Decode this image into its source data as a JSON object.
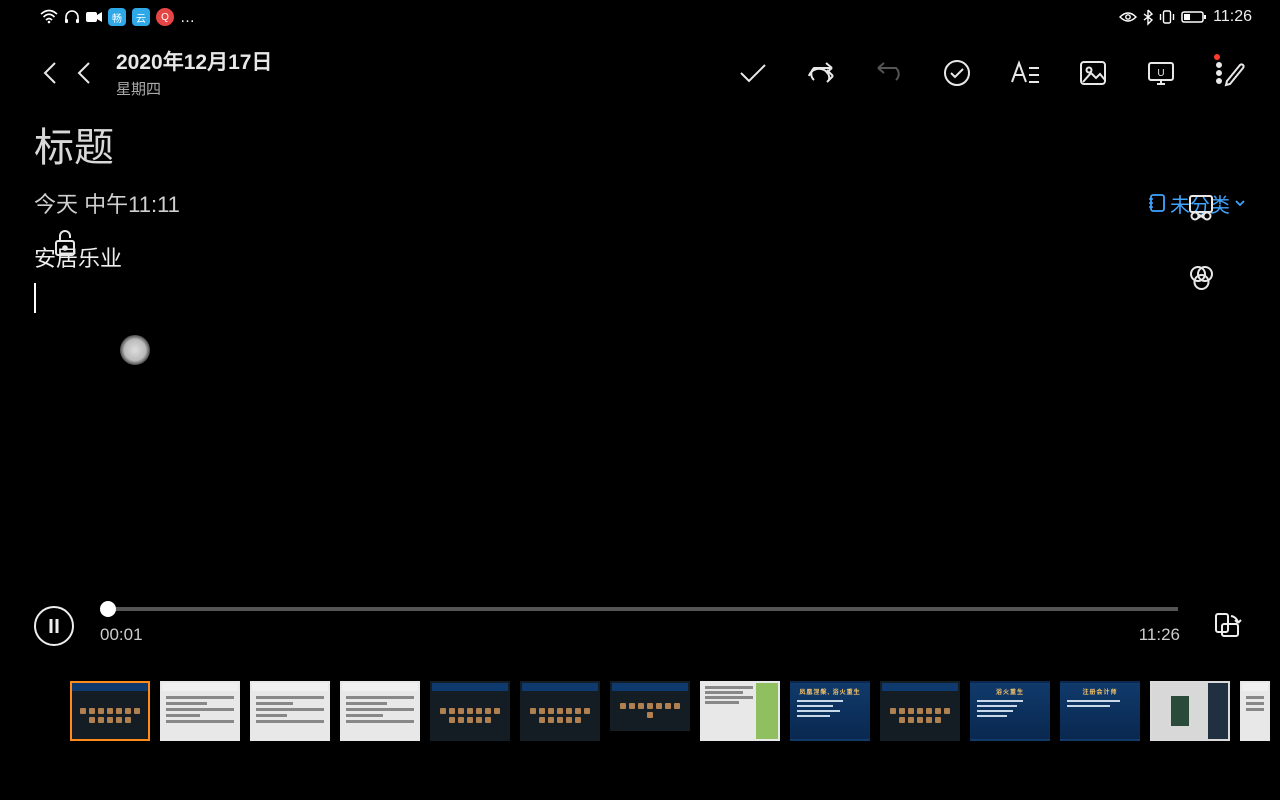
{
  "status": {
    "clock": "11:26"
  },
  "doc": {
    "date": "2020年12月17日",
    "weekday": "星期四",
    "title": "标题",
    "created": "今天 中午11:11",
    "category": "未分类",
    "body_line1": "安居乐业"
  },
  "player": {
    "current": "00:01",
    "total": "11:26"
  },
  "thumbs": {
    "blue_titles": [
      "凤凰涅槃, 浴火重生",
      "浴火重生",
      "注册会计师"
    ],
    "count": 14,
    "selected_index": 0
  }
}
